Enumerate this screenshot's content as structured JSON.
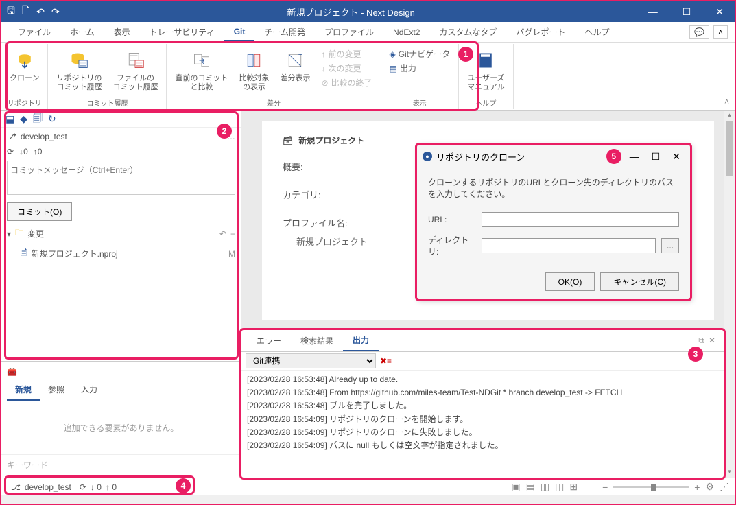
{
  "titlebar": {
    "title": "新規プロジェクト - Next Design"
  },
  "menu": {
    "items": [
      "ファイル",
      "ホーム",
      "表示",
      "トレーサビリティ",
      "Git",
      "チーム開発",
      "プロファイル",
      "NdExt2",
      "カスタムなタブ",
      "バグレポート",
      "ヘルプ"
    ],
    "active": "Git"
  },
  "ribbon": {
    "groups": [
      {
        "label": "リポジトリ",
        "items": [
          {
            "label": "クローン"
          }
        ]
      },
      {
        "label": "コミット履歴",
        "items": [
          {
            "label": "リポジトリの\nコミット履歴"
          },
          {
            "label": "ファイルの\nコミット履歴"
          }
        ]
      },
      {
        "label": "差分",
        "items": [
          {
            "label": "直前のコミット\nと比較"
          },
          {
            "label": "比較対象\nの表示"
          },
          {
            "label": "差分表示"
          }
        ],
        "small": [
          {
            "label": "前の変更",
            "disabled": true
          },
          {
            "label": "次の変更",
            "disabled": true
          },
          {
            "label": "比較の終了",
            "disabled": true
          }
        ]
      },
      {
        "label": "表示",
        "small": [
          {
            "label": "Gitナビゲータ"
          },
          {
            "label": "出力"
          }
        ]
      },
      {
        "label": "ヘルプ",
        "items": [
          {
            "label": "ユーザーズ\nマニュアル"
          }
        ]
      }
    ]
  },
  "sidebar": {
    "branch": "develop_test",
    "down": "0",
    "up": "0",
    "commit_placeholder": "コミットメッセージ（Ctrl+Enter）",
    "commit_btn": "コミット(O)",
    "changes_label": "変更",
    "file": "新規プロジェクト.nproj",
    "file_status": "M",
    "tabs": [
      "新規",
      "参照",
      "入力"
    ],
    "empty_msg": "追加できる要素がありません。",
    "keyword_placeholder": "キーワード"
  },
  "form": {
    "title": "新規プロジェクト",
    "rows": [
      {
        "label": "概要:",
        "value": ""
      },
      {
        "label": "カテゴリ:",
        "value": ""
      },
      {
        "label": "プロファイル名:",
        "value": "新規プロジェクト"
      }
    ]
  },
  "dialog": {
    "title": "リポジトリのクローン",
    "msg": "クローンするリポジトリのURLとクローン先のディレクトリのパスを入力してください。",
    "url_label": "URL:",
    "dir_label": "ディレクトリ:",
    "browse": "...",
    "ok": "OK(O)",
    "cancel": "キャンセル(C)"
  },
  "output": {
    "tabs": [
      "エラー",
      "検索結果",
      "出力"
    ],
    "active": "出力",
    "source": "Git連携",
    "lines": [
      "[2023/02/28 16:53:48] Already up to date.",
      "[2023/02/28 16:53:48] From https://github.com/miles-team/Test-NDGit  * branch            develop_test -> FETCH",
      "[2023/02/28 16:53:48] プルを完了しました。",
      "[2023/02/28 16:54:09] リポジトリのクローンを開始します。",
      "[2023/02/28 16:54:09] リポジトリのクローンに失敗しました。",
      "[2023/02/28 16:54:09] パスに null もしくは空文字が指定されました。"
    ]
  },
  "statusbar": {
    "branch": "develop_test",
    "down": "0",
    "up": "0"
  },
  "callouts": {
    "c1": "1",
    "c2": "2",
    "c3": "3",
    "c4": "4",
    "c5": "5"
  }
}
